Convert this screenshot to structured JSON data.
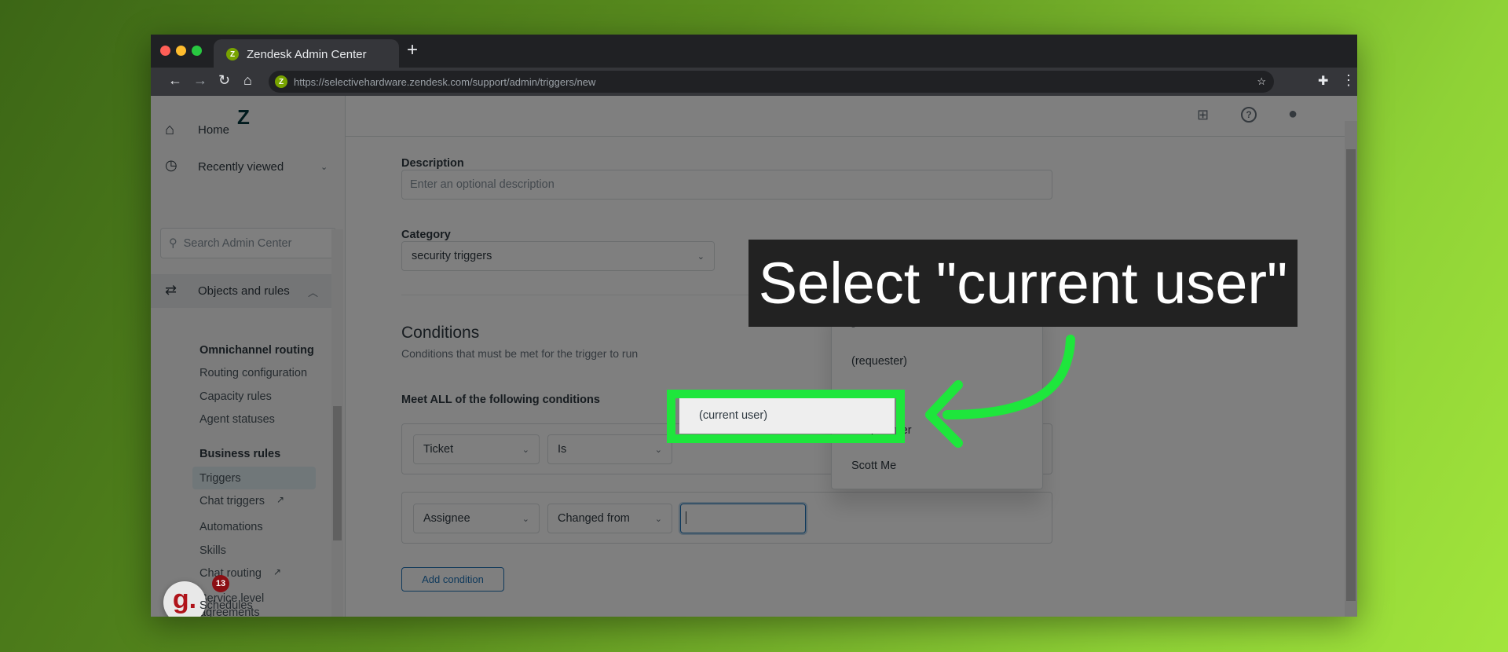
{
  "browser": {
    "tab_title": "Zendesk Admin Center",
    "new_tab": "+",
    "url": "https://selectivehardware.zendesk.com/support/admin/triggers/new",
    "favicon": "Z"
  },
  "sidebar": {
    "home": "Home",
    "recent": "Recently viewed",
    "search_placeholder": "Search Admin Center",
    "objects": "Objects and rules",
    "omni_header": "Omnichannel routing",
    "omni": [
      "Routing configuration",
      "Capacity rules",
      "Agent statuses"
    ],
    "biz_header": "Business rules",
    "biz": [
      "Triggers",
      "Chat triggers",
      "Automations",
      "Skills",
      "Chat routing",
      "Service level",
      "agreements",
      "Schedules"
    ]
  },
  "form": {
    "description_label": "Description",
    "description_placeholder": "Enter an optional description",
    "category_label": "Category",
    "category_value": "security triggers",
    "conditions_title": "Conditions",
    "conditions_sub": "Conditions that must be met for the trigger to run",
    "meet_all": "Meet ALL of the following conditions",
    "row1": {
      "field": "Ticket",
      "operator": "Is"
    },
    "row2": {
      "field": "Assignee",
      "operator": "Changed from",
      "value": ""
    },
    "add_condition": "Add condition"
  },
  "dropdown": {
    "options": [
      "-",
      "(requester)",
      "(current user)",
      "Meg Harper",
      "Scott Me"
    ],
    "highlighted": "(current user)"
  },
  "callout": {
    "text": "Select \"current user\"",
    "highlight_color": "#1ee63c"
  },
  "guidde_badge": {
    "logo": "g.",
    "count": "13"
  }
}
